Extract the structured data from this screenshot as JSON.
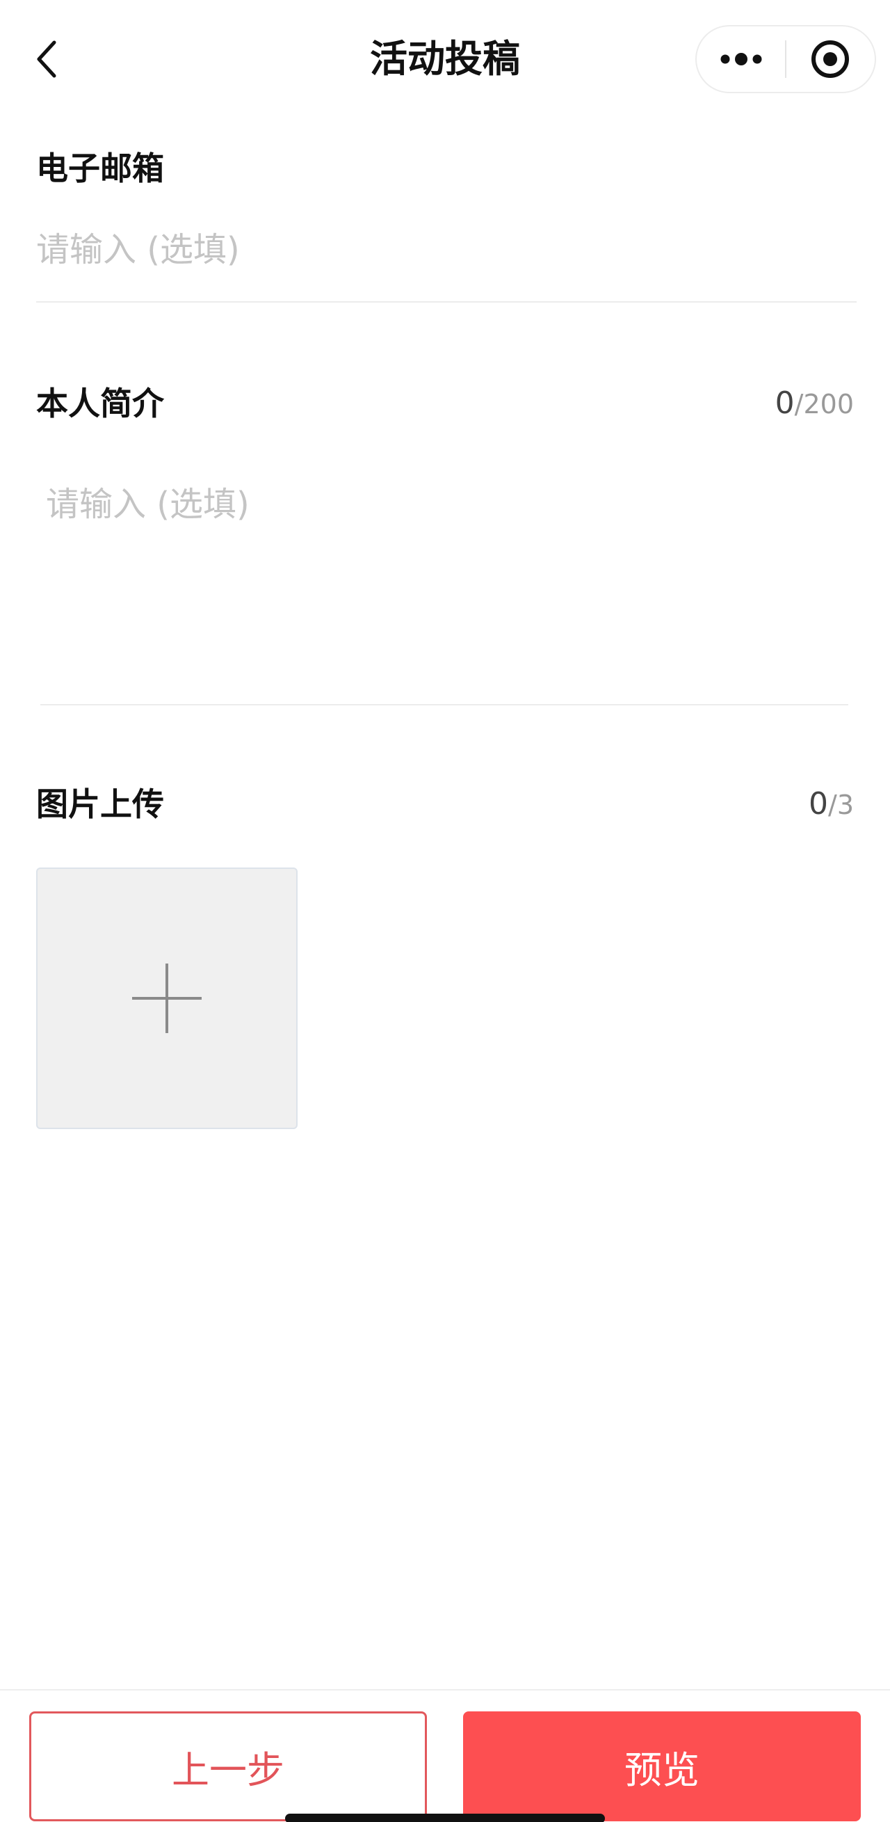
{
  "nav": {
    "title": "活动投稿",
    "back_icon": "chevron-left-icon",
    "more_icon": "more-dots-icon",
    "close_icon": "target-circle-icon"
  },
  "email": {
    "label": "电子邮箱",
    "placeholder": "请输入 (选填)",
    "value": ""
  },
  "intro": {
    "label": "本人简介",
    "count_current": "0",
    "count_max": "/200",
    "placeholder": "请输入 (选填)",
    "value": ""
  },
  "images": {
    "label": "图片上传",
    "count_current": "0",
    "count_max": "/3",
    "add_icon": "plus-icon"
  },
  "actions": {
    "prev_label": "上一步",
    "preview_label": "预览"
  },
  "colors": {
    "accent": "#fd4f51",
    "prev_border": "#e2585c",
    "placeholder": "#c4c4c4"
  }
}
